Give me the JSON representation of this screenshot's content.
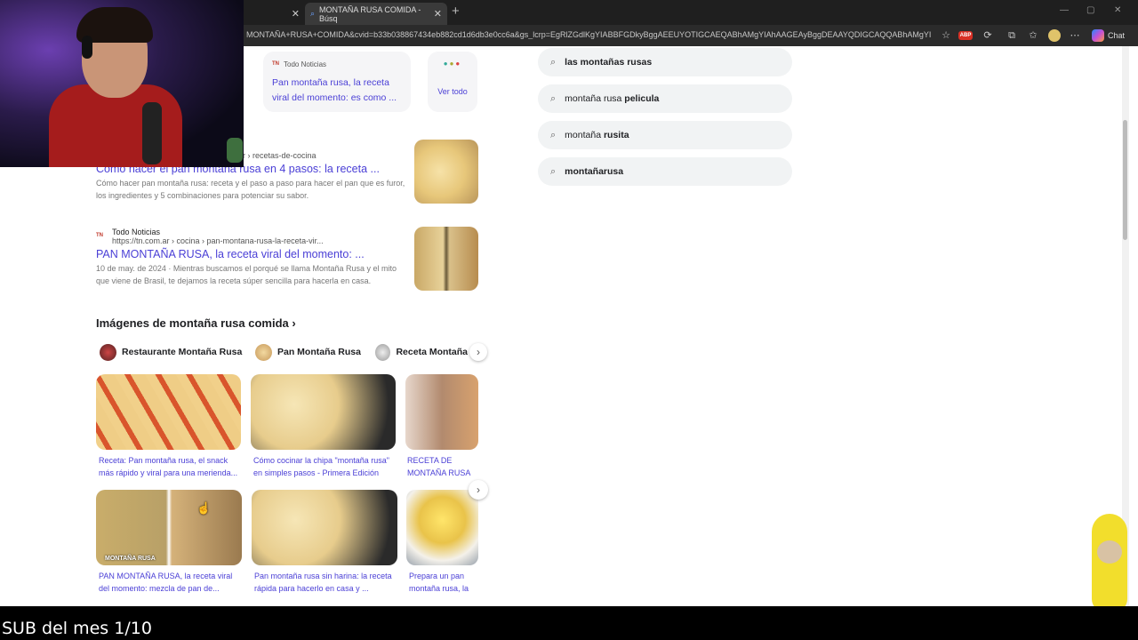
{
  "browser": {
    "tabs": [
      {
        "label": "",
        "active": false
      },
      {
        "label": "MONTAÑA RUSA COMIDA - Búsq",
        "active": true
      }
    ],
    "url": "MONTAÑA+RUSA+COMIDA&cvid=b33b038867434eb882cd1d6db3e0cc6a&gs_lcrp=EgRlZGdlKgYIABBFGDkyBggAEEUYOTIGCAEQABhAMgYIAhAAGEAyBggDEAAYQDIGCAQQABhAMgYIB...",
    "chat_label": "Chat",
    "adblock_label": "ABP"
  },
  "news_card": {
    "source": "Todo Noticias",
    "title": "Pan montaña rusa, la receta viral del momento: es como ...",
    "see_all": "Ver todo"
  },
  "results": [
    {
      "breadcrumb": "r › recetas-de-cocina",
      "title": "Cómo hacer el pan montaña rusa en 4 pasos: la receta ...",
      "snippet": "Cómo hacer pan montaña rusa: receta y el paso a paso para hacer el pan que es furor, los ingredientes y 5 combinaciones para potenciar su sabor."
    },
    {
      "site": "Todo Noticias",
      "breadcrumb": "https://tn.com.ar › cocina › pan-montana-rusa-la-receta-vir...",
      "title": "PAN MONTAÑA RUSA, la receta viral del momento: ...",
      "snippet": "10 de may. de 2024 · Mientras buscamos el porqué se llama Montaña Rusa y el mito que viene de Brasil, te dejamos la receta súper sencilla para hacerla en casa."
    }
  ],
  "images_section": {
    "title": "Imágenes de montaña rusa comida ›",
    "chips": [
      "Restaurante Montaña Rusa",
      "Pan Montaña Rusa",
      "Receta Montaña"
    ],
    "captions_row1": [
      "Receta: Pan montaña rusa, el snack más rápido y viral para una merienda...",
      "Cómo cocinar la chipa \"montaña rusa\" en simples pasos - Primera Edición",
      "RECETA DE MONTAÑA RUSA VIRAL: El paso a paso"
    ],
    "captions_row2": [
      "PAN MONTAÑA RUSA, la receta viral del momento: mezcla de pan de...",
      "Pan montaña rusa sin harina: la receta rápida para hacerlo en casa y ...",
      "Prepara un pan montaña rusa, la receta más viral y c"
    ],
    "image_label": "MONTAÑA RUSA"
  },
  "suggestions": [
    {
      "prefix": "",
      "bold": "las montañas rusas"
    },
    {
      "prefix": "montaña rusa ",
      "bold": "pelicula"
    },
    {
      "prefix": "montaña ",
      "bold": "rusita"
    },
    {
      "prefix": "",
      "bold": "montañarusa"
    }
  ],
  "overlay": {
    "sub_text": "SUB del mes 1/10"
  },
  "colors": {
    "link": "#4a3fd6",
    "chrome_dark": "#1f1f1f"
  }
}
